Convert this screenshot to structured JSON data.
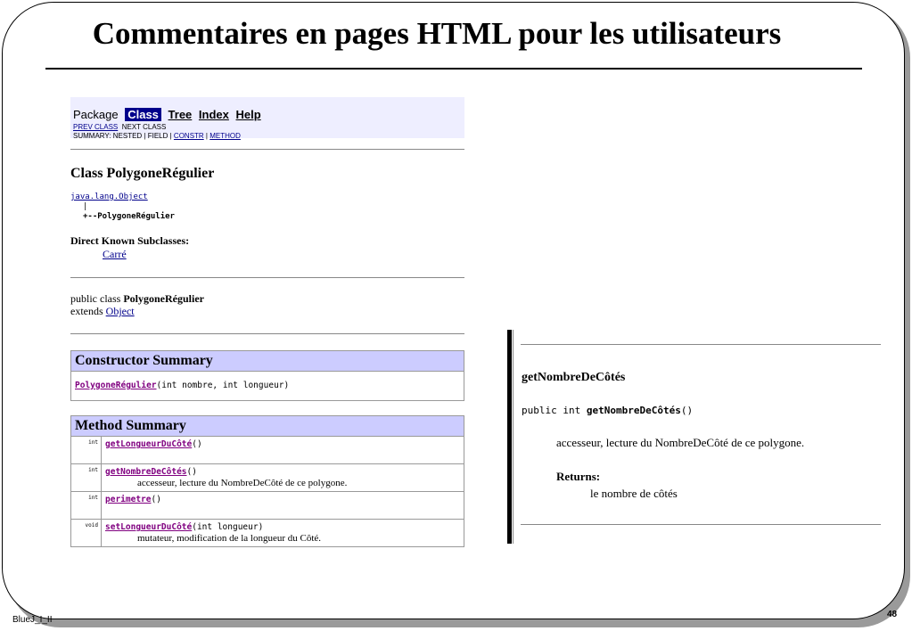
{
  "slide": {
    "title": "Commentaires en pages HTML pour les utilisateurs",
    "footer_left": "BlueJ_I_II",
    "page_number": "48"
  },
  "javadoc": {
    "nav": {
      "package": "Package",
      "class": "Class",
      "tree": "Tree",
      "index": "Index",
      "help": "Help",
      "prev_class": "PREV CLASS",
      "next_class": "NEXT CLASS",
      "summary_prefix": "SUMMARY: NESTED | FIELD | ",
      "constr": "CONSTR",
      "sep": " | ",
      "method": "METHOD"
    },
    "class_title": "Class PolygoneRégulier",
    "tree_parent": "java.lang.Object",
    "tree_bar": "|",
    "tree_child": "+--PolygoneRégulier",
    "subclasses_label": "Direct Known Subclasses:",
    "subclass": "Carré",
    "decl_line1_prefix": "public class ",
    "decl_line1_name": "PolygoneRégulier",
    "decl_line2_prefix": "extends ",
    "decl_line2_link": "Object",
    "constructor_summary_title": "Constructor Summary",
    "constructor": {
      "name": "PolygoneRégulier",
      "args": "(int nombre, int longueur)"
    },
    "method_summary_title": "Method Summary",
    "methods": [
      {
        "type": "int",
        "name": "getLongueurDuCôté",
        "args": "()",
        "desc": ""
      },
      {
        "type": "int",
        "name": "getNombreDeCôtés",
        "args": "()",
        "desc": "accesseur, lecture du NombreDeCôté de ce polygone."
      },
      {
        "type": "int",
        "name": "perimetre",
        "args": "()",
        "desc": ""
      },
      {
        "type": "void",
        "name": "setLongueurDuCôté",
        "args": "(int longueur)",
        "desc": "mutateur, modification de la longueur du Côté."
      }
    ]
  },
  "detail": {
    "name": "getNombreDeCôtés",
    "sig_prefix": "public int ",
    "sig_name": "getNombreDeCôtés",
    "sig_args": "()",
    "description": "accesseur, lecture du NombreDeCôté de ce polygone.",
    "returns_label": "Returns:",
    "returns_value": "le nombre de côtés"
  }
}
